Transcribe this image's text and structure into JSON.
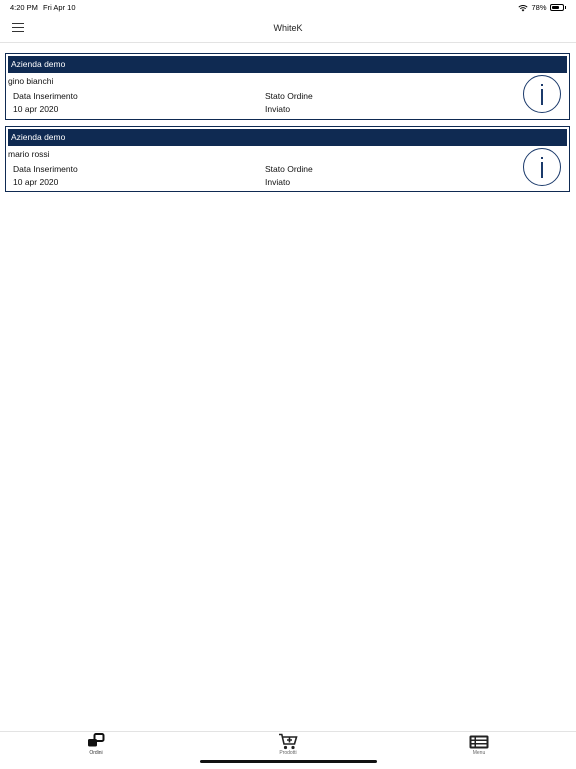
{
  "status_bar": {
    "time": "4:20 PM",
    "date": "Fri Apr 10",
    "battery": "78%",
    "battery_level": 0.78
  },
  "nav": {
    "title": "WhiteK"
  },
  "orders": [
    {
      "company": "Azienda demo",
      "customer": "gino bianchi",
      "date_label": "Data Inserimento",
      "date_value": "10 apr 2020",
      "status_label": "Stato Ordine",
      "status_value": "Inviato"
    },
    {
      "company": "Azienda demo",
      "customer": "mario rossi",
      "date_label": "Data Inserimento",
      "date_value": "10 apr 2020",
      "status_label": "Stato Ordine",
      "status_value": "Inviato"
    }
  ],
  "tabs": [
    {
      "label": "Ordini",
      "icon": "orders-icon",
      "active": true
    },
    {
      "label": "Prodotti",
      "icon": "cart-add-icon",
      "active": false
    },
    {
      "label": "Menu",
      "icon": "list-icon",
      "active": false
    }
  ],
  "colors": {
    "accent": "#0f2a52",
    "info_icon": "#1b3a6b"
  }
}
